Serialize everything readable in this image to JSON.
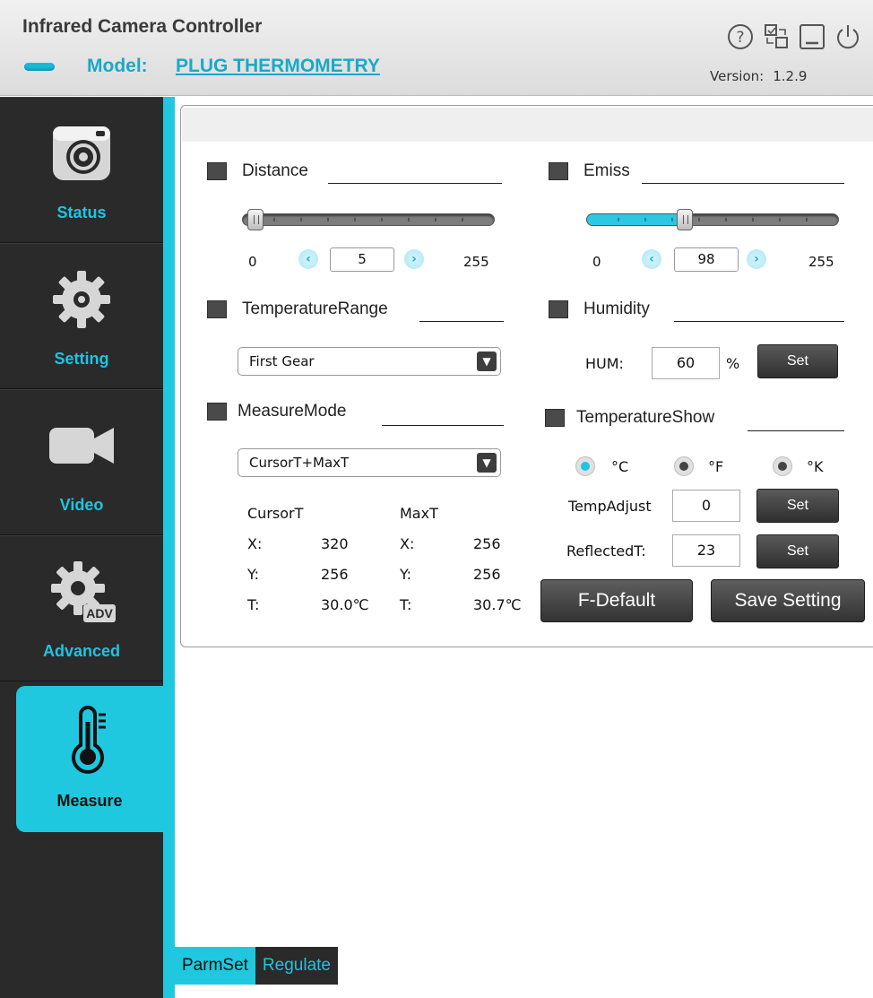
{
  "header": {
    "title": "Infrared Camera Controller",
    "model_label": "Model:",
    "model_name": "PLUG THERMOMETRY",
    "version_label": "Version:",
    "version": "1.2.9",
    "icons": [
      "help-icon",
      "switch-device-icon",
      "minimize-icon",
      "power-icon"
    ]
  },
  "sidebar": {
    "items": [
      {
        "label": "Status",
        "icon": "camera-icon"
      },
      {
        "label": "Setting",
        "icon": "gear-icon"
      },
      {
        "label": "Video",
        "icon": "video-camera-icon"
      },
      {
        "label": "Advanced",
        "icon": "advanced-gear-icon"
      },
      {
        "label": "Measure",
        "icon": "thermometer-icon",
        "active": true
      }
    ]
  },
  "tabs": [
    {
      "label": "ParmSet",
      "active": true
    },
    {
      "label": "Regulate",
      "active": false
    }
  ],
  "distance": {
    "label": "Distance",
    "min": "0",
    "max": "255",
    "value": "5",
    "level": 0.02
  },
  "emiss": {
    "label": "Emiss",
    "min": "0",
    "max": "255",
    "value": "98",
    "level": 0.38
  },
  "temperature_range": {
    "label": "TemperatureRange",
    "selected": "First Gear"
  },
  "humidity": {
    "label": "Humidity",
    "field_label": "HUM:",
    "value": "60",
    "unit": "%",
    "set_label": "Set"
  },
  "measure_mode": {
    "label": "MeasureMode",
    "selected": "CursorT+MaxT"
  },
  "temperature_show": {
    "label": "TemperatureShow",
    "units": [
      {
        "label": "°C",
        "selected": true
      },
      {
        "label": "°F",
        "selected": false
      },
      {
        "label": "°K",
        "selected": false
      }
    ],
    "temp_adjust_label": "TempAdjust",
    "temp_adjust_value": "0",
    "reflected_label": "ReflectedT:",
    "reflected_value": "23",
    "set_label": "Set"
  },
  "readings": {
    "cursor": {
      "title": "CursorT",
      "x_label": "X:",
      "x": "320",
      "y_label": "Y:",
      "y": "256",
      "t_label": "T:",
      "t": "30.0℃"
    },
    "max": {
      "title": "MaxT",
      "x_label": "X:",
      "x": "256",
      "y_label": "Y:",
      "y": "256",
      "t_label": "T:",
      "t": "30.7℃"
    }
  },
  "actions": {
    "default_label": "F-Default",
    "save_label": "Save Setting"
  },
  "colors": {
    "accent": "#1fc8de",
    "sidebar": "#2a2a2a",
    "brand_text": "#1aa9c8"
  }
}
